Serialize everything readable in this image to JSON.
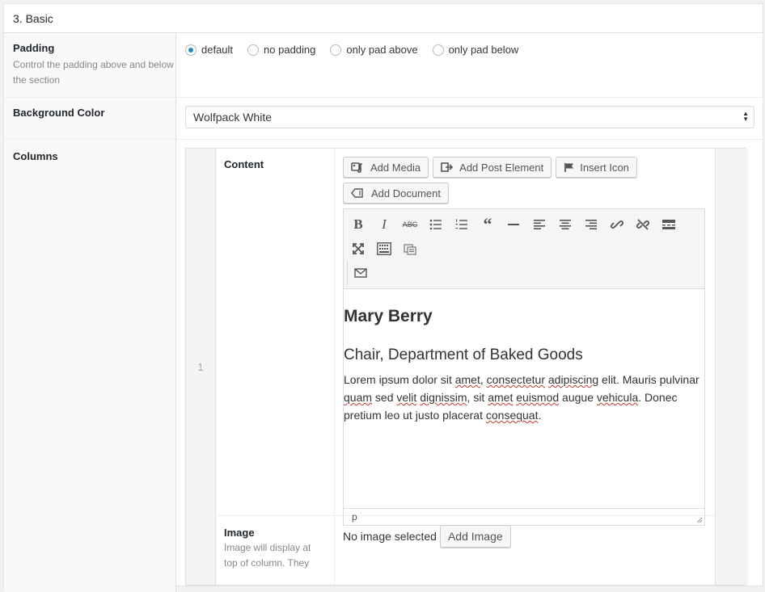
{
  "section": {
    "title": "3. Basic"
  },
  "padding": {
    "label": "Padding",
    "description": "Control the padding above and below the section",
    "options": [
      "default",
      "no padding",
      "only pad above",
      "only pad below"
    ],
    "selected": "default"
  },
  "background": {
    "label": "Background Color",
    "selected": "Wolfpack White"
  },
  "columns": {
    "label": "Columns",
    "row_number": "1",
    "content": {
      "label": "Content",
      "buttons": {
        "add_media": "Add Media",
        "add_post_element": "Add Post Element",
        "insert_icon": "Insert Icon",
        "add_document": "Add Document"
      },
      "editor": {
        "heading": "Mary Berry",
        "subheading": "Chair, Department of Baked Goods",
        "paragraph_parts": [
          "Lorem ipsum dolor sit ",
          "amet",
          ", ",
          "consectetur",
          " ",
          "adipiscing",
          " elit. Mauris pulvinar ",
          "quam",
          " sed ",
          "velit",
          " ",
          "dignissim",
          ", sit ",
          "amet",
          " ",
          "euismod",
          " augue ",
          "vehicula",
          ". Donec pretium leo ut justo placerat ",
          "consequat",
          "."
        ],
        "status_path": "p"
      }
    },
    "image": {
      "label": "Image",
      "description": "Image will display at top of column. They",
      "status": "No image selected",
      "add_button": "Add Image"
    }
  },
  "colors": {
    "accent": "#1e8cbe",
    "spell": "#c0392b"
  }
}
